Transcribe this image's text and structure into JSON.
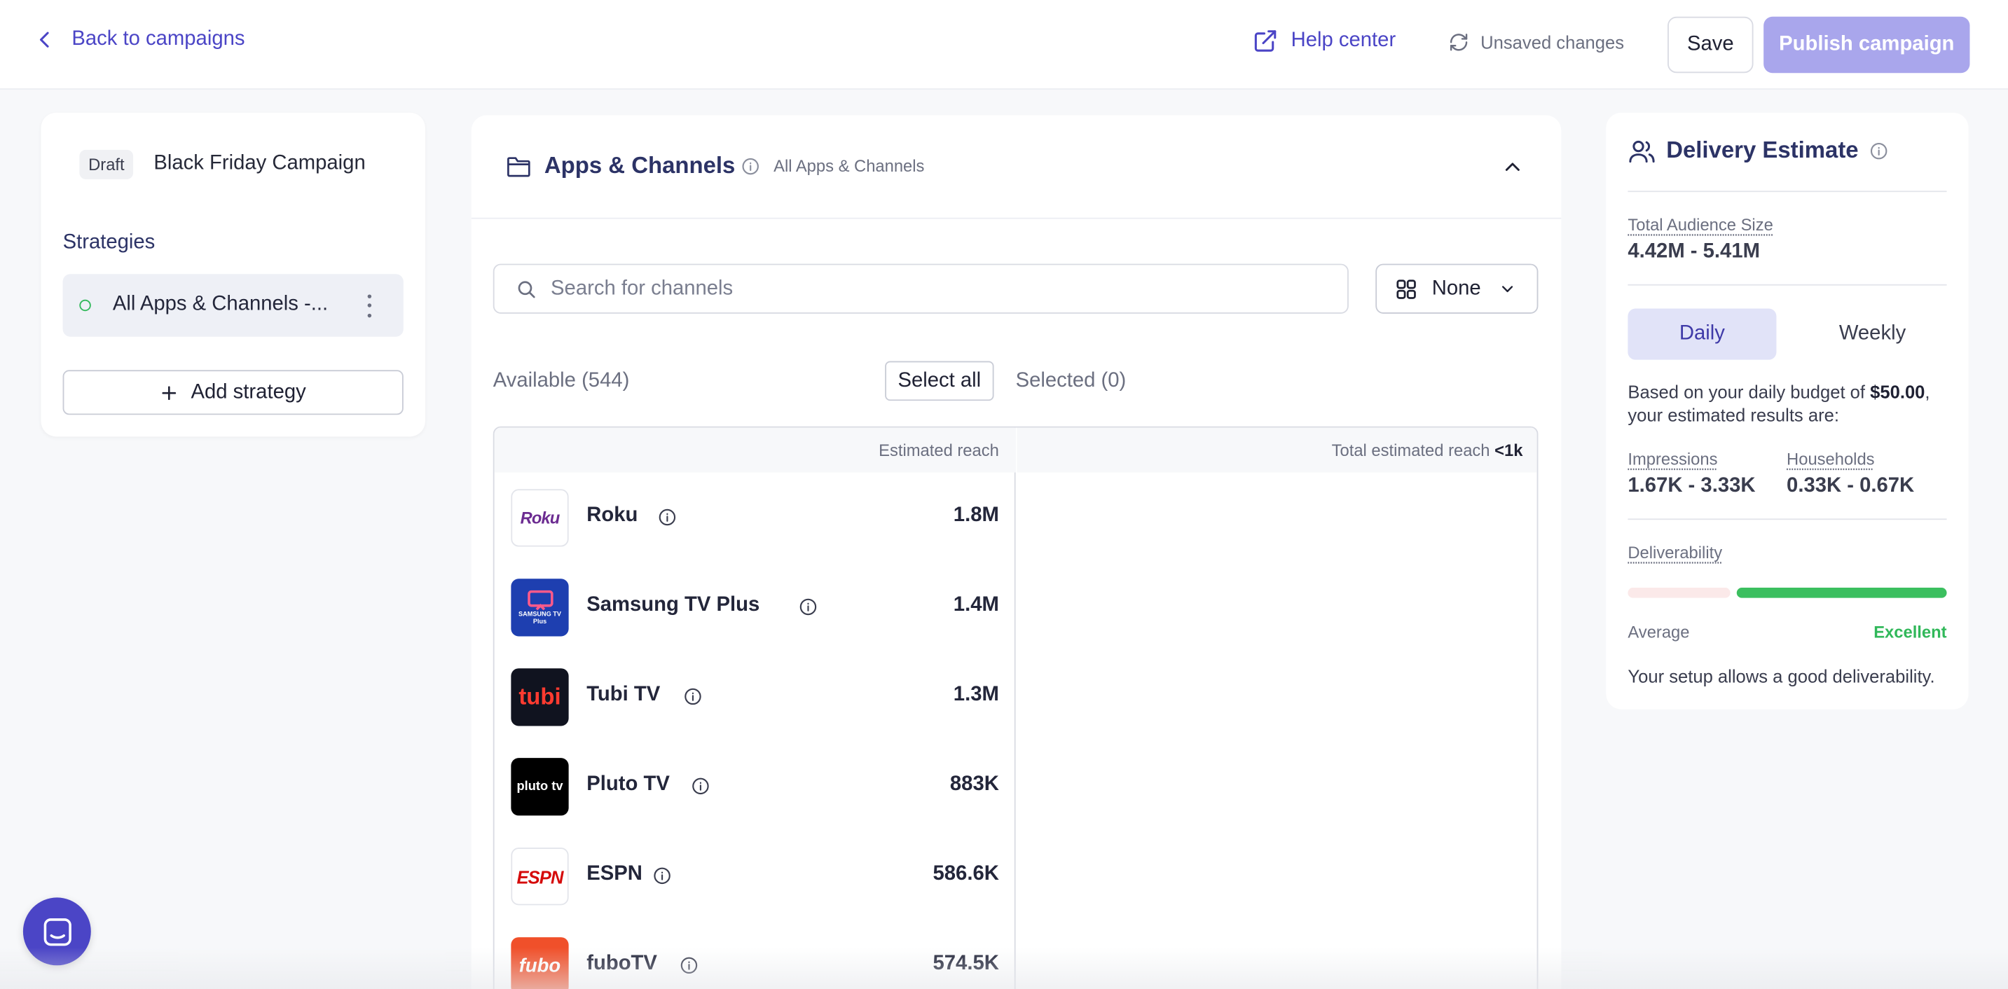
{
  "topbar": {
    "back_label": "Back to campaigns",
    "help_label": "Help center",
    "unsaved_label": "Unsaved changes",
    "save_label": "Save",
    "publish_label": "Publish campaign"
  },
  "campaign": {
    "status_badge": "Draft",
    "name": "Black Friday Campaign"
  },
  "strategies": {
    "title": "Strategies",
    "items": [
      {
        "label": "All Apps & Channels -..."
      }
    ],
    "add_label": "Add strategy"
  },
  "apps": {
    "title": "Apps & Channels",
    "subtitle": "All Apps & Channels",
    "search_placeholder": "Search for channels",
    "group_by": "None",
    "available_label": "Available (544)",
    "select_all_label": "Select all",
    "selected_label": "Selected (0)",
    "est_reach_header": "Estimated reach",
    "total_reach_header": "Total estimated reach",
    "total_reach_value": "<1k",
    "channels": [
      {
        "name": "Roku",
        "reach": "1.8M",
        "logo_text": "Roku"
      },
      {
        "name": "Samsung TV Plus",
        "reach": "1.4M",
        "logo_text": "SAMSUNG TV Plus"
      },
      {
        "name": "Tubi TV",
        "reach": "1.3M",
        "logo_text": "tubi"
      },
      {
        "name": "Pluto TV",
        "reach": "883K",
        "logo_text": "pluto tv"
      },
      {
        "name": "ESPN",
        "reach": "586.6K",
        "logo_text": "ESPN"
      },
      {
        "name": "fuboTV",
        "reach": "574.5K",
        "logo_text": "fubo"
      }
    ]
  },
  "delivery": {
    "title": "Delivery Estimate",
    "audience_label": "Total Audience Size",
    "audience_value": "4.42M - 5.41M",
    "tabs": {
      "daily": "Daily",
      "weekly": "Weekly"
    },
    "budget_prefix": "Based on your daily budget of ",
    "budget_amount": "$50.00",
    "budget_suffix": ", your estimated results are:",
    "impressions_label": "Impressions",
    "impressions_value": "1.67K - 3.33K",
    "households_label": "Households",
    "households_value": "0.33K - 0.67K",
    "deliverability_label": "Deliverability",
    "deliverability_level": 0.67,
    "level_low": "Average",
    "level_high": "Excellent",
    "note": "Your setup allows a good deliverability."
  },
  "colors": {
    "accent": "#4b45c6",
    "publish_disabled": "#a9a6ec",
    "success": "#31b85a"
  }
}
